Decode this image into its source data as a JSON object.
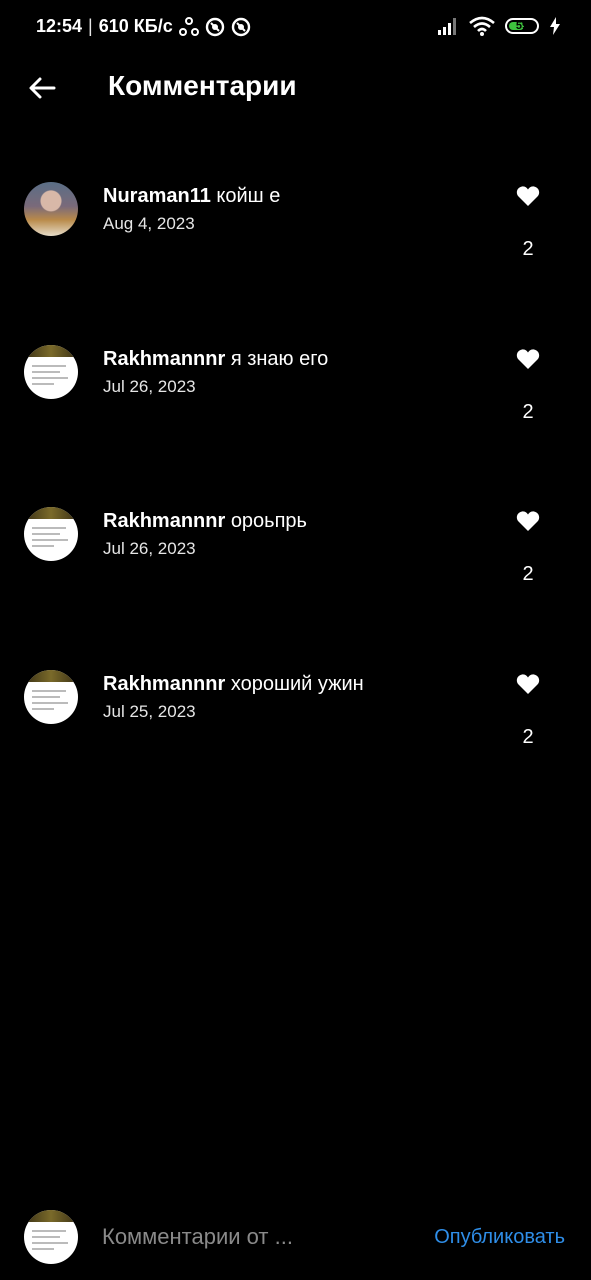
{
  "status_bar": {
    "time": "12:54",
    "net_speed": "610 КБ/с",
    "battery": "59",
    "battery_level": 0.59,
    "battery_color": "#3ec33e"
  },
  "header": {
    "title": "Комментарии"
  },
  "comments": [
    {
      "username": "Nuraman11",
      "text": "койш е",
      "date": "Aug 4, 2023",
      "likes": "2",
      "avatar": "photo-avatar"
    },
    {
      "username": "Rakhmannnr",
      "text": "я знаю его",
      "date": "Jul 26, 2023",
      "likes": "2",
      "avatar": "document-avatar"
    },
    {
      "username": "Rakhmannnr",
      "text": "ороьпрь",
      "date": "Jul 26, 2023",
      "likes": "2",
      "avatar": "document-avatar"
    },
    {
      "username": "Rakhmannnr",
      "text": "хороший ужин",
      "date": "Jul 25, 2023",
      "likes": "2",
      "avatar": "document-avatar"
    }
  ],
  "composer": {
    "placeholder": "Комментарии от ...",
    "publish_label": "Опубликовать",
    "accent_color": "#2f8ee8"
  },
  "icons": {
    "back": "arrow-left-icon",
    "like": "heart-icon",
    "signal": "signal-icon",
    "wifi": "wifi-icon",
    "charging": "lightning-icon"
  }
}
